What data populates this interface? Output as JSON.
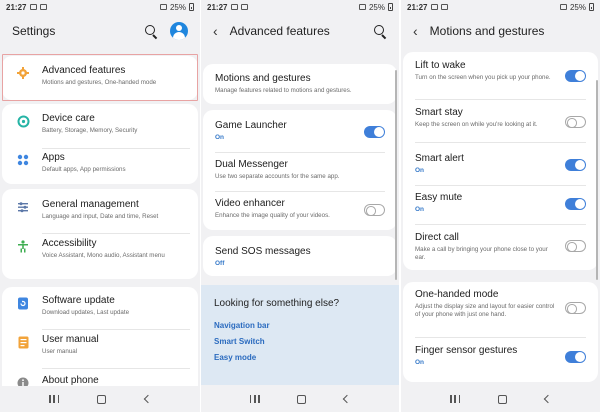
{
  "status_bar": {
    "time": "21:27",
    "battery": "25%"
  },
  "screen1": {
    "title": "Settings",
    "items": [
      {
        "title": "Advanced features",
        "subtitle": "Motions and gestures, One-handed mode",
        "icon": "gear-plus-icon",
        "color": "#f2a33a"
      },
      {
        "title": "Device care",
        "subtitle": "Battery, Storage, Memory, Security",
        "icon": "device-care-icon",
        "color": "#25b4a5"
      },
      {
        "title": "Apps",
        "subtitle": "Default apps, App permissions",
        "icon": "apps-grid-icon",
        "color": "#3f86e0"
      },
      {
        "title": "General management",
        "subtitle": "Language and input, Date and time, Reset",
        "icon": "sliders-icon",
        "color": "#5c78a8"
      },
      {
        "title": "Accessibility",
        "subtitle": "Voice Assistant, Mono audio, Assistant menu",
        "icon": "accessibility-icon",
        "color": "#3fae52"
      },
      {
        "title": "Software update",
        "subtitle": "Download updates, Last update",
        "icon": "software-update-icon",
        "color": "#3f86e0"
      },
      {
        "title": "User manual",
        "subtitle": "User manual",
        "icon": "manual-icon",
        "color": "#f2a33a"
      },
      {
        "title": "About phone",
        "subtitle": "",
        "icon": "info-icon",
        "color": "#8a8a8a"
      }
    ]
  },
  "screen2": {
    "title": "Advanced features",
    "items": [
      {
        "title": "Motions and gestures",
        "subtitle": "Manage features related to motions and gestures."
      },
      {
        "title": "Game Launcher",
        "status": "On",
        "toggle": true
      },
      {
        "title": "Dual Messenger",
        "subtitle": "Use two separate accounts for the same app."
      },
      {
        "title": "Video enhancer",
        "subtitle": "Enhance the image quality of your videos.",
        "toggle": false
      },
      {
        "title": "Send SOS messages",
        "status": "Off"
      }
    ],
    "looking": {
      "heading": "Looking for something else?",
      "links": [
        "Navigation bar",
        "Smart Switch",
        "Easy mode"
      ]
    }
  },
  "screen3": {
    "title": "Motions and gestures",
    "items": [
      {
        "title": "Lift to wake",
        "subtitle": "Turn on the screen when you pick up your phone.",
        "toggle": true
      },
      {
        "title": "Smart stay",
        "subtitle": "Keep the screen on while you're looking at it.",
        "toggle": false
      },
      {
        "title": "Smart alert",
        "status": "On",
        "toggle": true
      },
      {
        "title": "Easy mute",
        "status": "On",
        "toggle": true
      },
      {
        "title": "Direct call",
        "subtitle": "Make a call by bringing your phone close to your ear.",
        "toggle": false
      },
      {
        "title": "One-handed mode",
        "subtitle": "Adjust the display size and layout for easier control of your phone with just one hand.",
        "toggle": false
      },
      {
        "title": "Finger sensor gestures",
        "status": "On",
        "toggle": true
      }
    ]
  }
}
